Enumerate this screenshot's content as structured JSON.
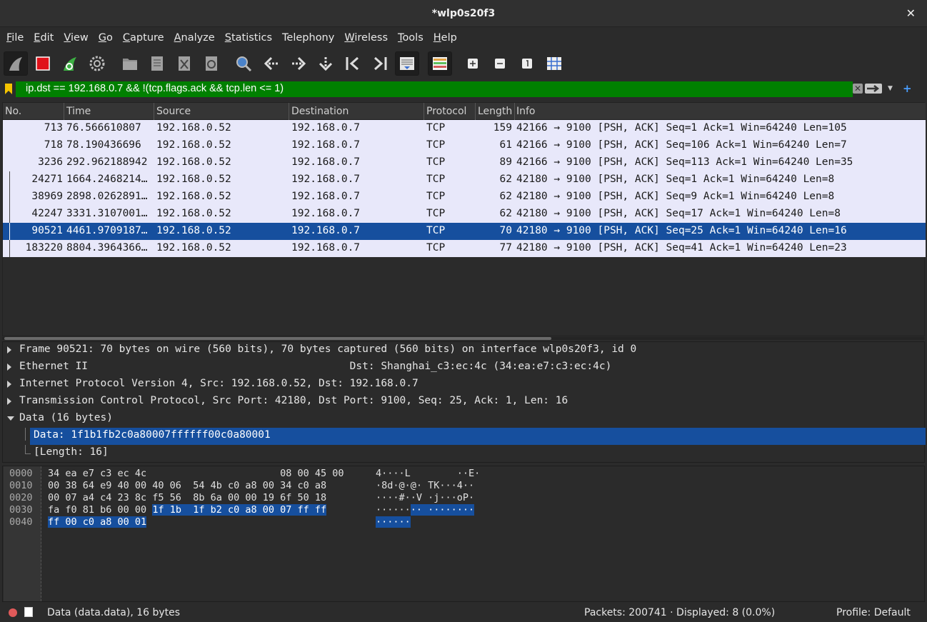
{
  "window": {
    "title": "*wlp0s20f3",
    "close": "✕"
  },
  "menu": [
    {
      "label": "File",
      "u": "F",
      "rest": "ile"
    },
    {
      "label": "Edit",
      "u": "E",
      "rest": "dit"
    },
    {
      "label": "View",
      "u": "V",
      "rest": "iew"
    },
    {
      "label": "Go",
      "u": "G",
      "rest": "o"
    },
    {
      "label": "Capture",
      "u": "C",
      "rest": "apture"
    },
    {
      "label": "Analyze",
      "u": "A",
      "rest": "nalyze"
    },
    {
      "label": "Statistics",
      "u": "S",
      "rest": "tatistics"
    },
    {
      "label": "Telephony",
      "u": "",
      "rest": "Telephony"
    },
    {
      "label": "Wireless",
      "u": "W",
      "rest": "ireless"
    },
    {
      "label": "Tools",
      "u": "T",
      "rest": "ools"
    },
    {
      "label": "Help",
      "u": "H",
      "rest": "elp"
    }
  ],
  "filter": {
    "expression": "ip.dst == 192.168.0.7 && !(tcp.flags.ack && tcp.len <= 1)",
    "clear_symbol": "✕",
    "color": "#008000"
  },
  "packet_list": {
    "columns": [
      "No.",
      "Time",
      "Source",
      "Destination",
      "Protocol",
      "Length",
      "Info"
    ],
    "rows": [
      {
        "no": "713",
        "time": "76.566610807",
        "src": "192.168.0.52",
        "dst": "192.168.0.7",
        "proto": "TCP",
        "len": "159",
        "info": "42166 → 9100 [PSH, ACK] Seq=1 Ack=1 Win=64240 Len=105"
      },
      {
        "no": "718",
        "time": "78.190436696",
        "src": "192.168.0.52",
        "dst": "192.168.0.7",
        "proto": "TCP",
        "len": "61",
        "info": "42166 → 9100 [PSH, ACK] Seq=106 Ack=1 Win=64240 Len=7"
      },
      {
        "no": "3236",
        "time": "292.962188942",
        "src": "192.168.0.52",
        "dst": "192.168.0.7",
        "proto": "TCP",
        "len": "89",
        "info": "42166 → 9100 [PSH, ACK] Seq=113 Ack=1 Win=64240 Len=35"
      },
      {
        "no": "24271",
        "time": "1664.2468214…",
        "src": "192.168.0.52",
        "dst": "192.168.0.7",
        "proto": "TCP",
        "len": "62",
        "info": "42180 → 9100 [PSH, ACK] Seq=1 Ack=1 Win=64240 Len=8"
      },
      {
        "no": "38969",
        "time": "2898.0262891…",
        "src": "192.168.0.52",
        "dst": "192.168.0.7",
        "proto": "TCP",
        "len": "62",
        "info": "42180 → 9100 [PSH, ACK] Seq=9 Ack=1 Win=64240 Len=8"
      },
      {
        "no": "42247",
        "time": "3331.3107001…",
        "src": "192.168.0.52",
        "dst": "192.168.0.7",
        "proto": "TCP",
        "len": "62",
        "info": "42180 → 9100 [PSH, ACK] Seq=17 Ack=1 Win=64240 Len=8"
      },
      {
        "no": "90521",
        "time": "4461.9709187…",
        "src": "192.168.0.52",
        "dst": "192.168.0.7",
        "proto": "TCP",
        "len": "70",
        "info": "42180 → 9100 [PSH, ACK] Seq=25 Ack=1 Win=64240 Len=16"
      },
      {
        "no": "183220",
        "time": "8804.3964366…",
        "src": "192.168.0.52",
        "dst": "192.168.0.7",
        "proto": "TCP",
        "len": "77",
        "info": "42180 → 9100 [PSH, ACK] Seq=41 Ack=1 Win=64240 Len=23"
      }
    ],
    "selected_index": 6
  },
  "details": {
    "frame": "Frame 90521: 70 bytes on wire (560 bits), 70 bytes captured (560 bits) on interface wlp0s20f3, id 0",
    "ethernet": "Ethernet II                                          Dst: Shanghai_c3:ec:4c (34:ea:e7:c3:ec:4c)",
    "ip": "Internet Protocol Version 4, Src: 192.168.0.52, Dst: 192.168.0.7",
    "tcp": "Transmission Control Protocol, Src Port: 42180, Dst Port: 9100, Seq: 25, Ack: 1, Len: 16",
    "data": "Data (16 bytes)",
    "data_value": "Data: 1f1b1fb2c0a80007ffffff00c0a80001",
    "data_length": "[Length: 16]"
  },
  "bytes": {
    "rows": [
      {
        "off": "0000",
        "hex": "34 ea e7 c3 ec 4c                       08 00 45 00",
        "hex_sel": "",
        "hex_after": "",
        "asc": "4····L        ··E·",
        "asc_sel": ""
      },
      {
        "off": "0010",
        "hex": "00 38 64 e9 40 00 40 06  54 4b c0 a8 00 34 c0 a8",
        "hex_sel": "",
        "hex_after": "",
        "asc": "·8d·@·@· TK···4··",
        "asc_sel": ""
      },
      {
        "off": "0020",
        "hex": "00 07 a4 c4 23 8c f5 56  8b 6a 00 00 19 6f 50 18",
        "hex_sel": "",
        "hex_after": "",
        "asc": "····#··V ·j···oP·",
        "asc_sel": ""
      },
      {
        "off": "0030",
        "hex": "fa f0 81 b6 00 00 ",
        "hex_sel": "1f 1b  1f b2 c0 a8 00 07 ff ff",
        "hex_after": "",
        "asc": "······",
        "asc_sel": "·· ········"
      },
      {
        "off": "0040",
        "hex": "",
        "hex_sel": "ff 00 c0 a8 00 01",
        "hex_after": "",
        "asc": "",
        "asc_sel": "······"
      }
    ]
  },
  "status": {
    "field": "Data (data.data), 16 bytes",
    "packets": "Packets: 200741 · Displayed: 8 (0.0%)",
    "profile": "Profile: Default"
  },
  "toolbar_icons": [
    "shark-fin-icon",
    "stop-capture-icon",
    "restart-capture-icon",
    "capture-options-icon",
    "open-file-icon",
    "save-file-icon",
    "close-file-icon",
    "reload-file-icon",
    "find-packet-icon",
    "go-back-icon",
    "go-forward-icon",
    "go-to-packet-icon",
    "first-packet-icon",
    "last-packet-icon",
    "autoscroll-icon",
    "colorize-icon",
    "zoom-in-icon",
    "zoom-out-icon",
    "normal-size-icon",
    "resize-columns-icon"
  ]
}
